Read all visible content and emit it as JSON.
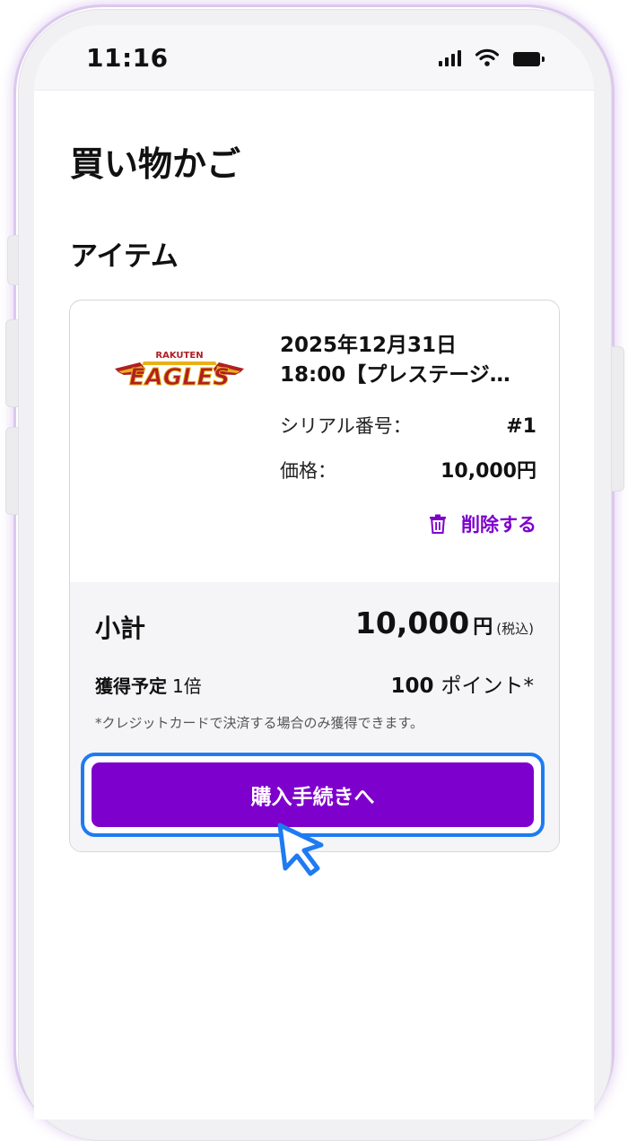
{
  "status_bar": {
    "time": "11:16",
    "icons": [
      "signal-icon",
      "wifi-icon",
      "battery-icon"
    ]
  },
  "page": {
    "title": "買い物かご",
    "section_title": "アイテム"
  },
  "item": {
    "logo": {
      "top_text": "RAKUTEN",
      "main_text": "EAGLES"
    },
    "title_line1": "2025年12月31日",
    "title_line2": "18:00【プレステージ…",
    "serial_label": "シリアル番号：",
    "serial_value": "#1",
    "price_label": "価格：",
    "price_value": "10,000円",
    "delete_label": "削除する"
  },
  "summary": {
    "subtotal_label": "小計",
    "subtotal_value": "10,000",
    "subtotal_currency": "円",
    "tax_note": "(税込)",
    "points_label": "獲得予定",
    "points_multiplier": "1倍",
    "points_value": "100",
    "points_unit": "ポイント*",
    "note": "*クレジットカードで決済する場合のみ獲得できます。"
  },
  "checkout_button": {
    "label": "購入手続きへ"
  },
  "colors": {
    "accent": "#7e00cc",
    "focus_ring": "#1e7bf2",
    "logo_red": "#b01e23",
    "logo_gold": "#e7b118"
  }
}
